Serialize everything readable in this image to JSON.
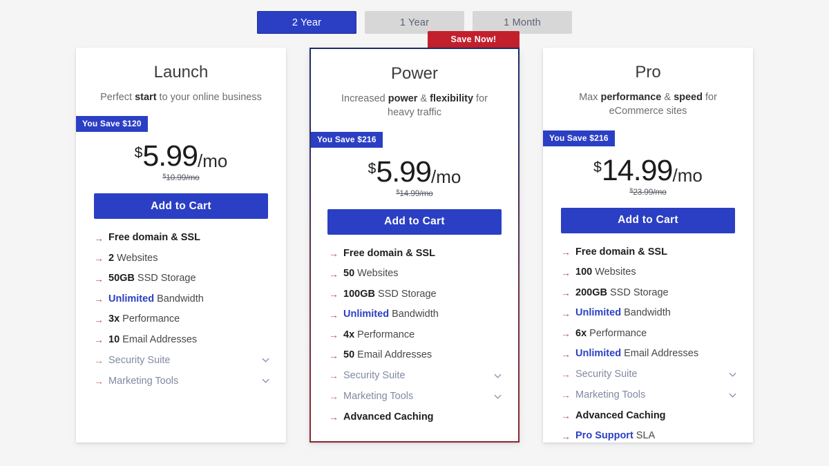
{
  "term_toggle": {
    "options": [
      {
        "label": "2 Year",
        "active": true
      },
      {
        "label": "1 Year",
        "active": false
      },
      {
        "label": "1 Month",
        "active": false
      }
    ]
  },
  "ribbon": {
    "label": "Save Now!",
    "color": "#c3202e"
  },
  "colors": {
    "accent_blue": "#2b3fc4",
    "ribbon_red": "#c3202e",
    "arrow_rose": "#b4515f",
    "muted_text": "#8189a3",
    "page_background": "#f5f5f5"
  },
  "icons": {
    "feature_arrow": "arrow-right-icon",
    "expand": "chevron-down-icon"
  },
  "plans": [
    {
      "name": "Launch",
      "tagline_pre": "Perfect ",
      "tagline_bold": "start",
      "tagline_post": " to your online business",
      "save_badge": "You Save $120",
      "currency": "$",
      "price": "5.99",
      "per": "/mo",
      "old_price": "10.99/mo",
      "cta": "Add to Cart",
      "featured": false,
      "features": [
        {
          "bold": "Free domain & SSL",
          "rest": "",
          "style": "allbold"
        },
        {
          "bold": "2",
          "rest": " Websites",
          "style": "normal"
        },
        {
          "bold": "50GB",
          "rest": " SSD Storage",
          "style": "normal"
        },
        {
          "bold": "Unlimited",
          "rest": " Bandwidth",
          "style": "highlight"
        },
        {
          "bold": "3x",
          "rest": " Performance",
          "style": "normal"
        },
        {
          "bold": "10",
          "rest": " Email Addresses",
          "style": "normal"
        },
        {
          "bold": "",
          "rest": "Security Suite",
          "style": "muted",
          "chevron": true
        },
        {
          "bold": "",
          "rest": "Marketing Tools",
          "style": "muted",
          "chevron": true
        }
      ]
    },
    {
      "name": "Power",
      "tagline_pre": "Increased ",
      "tagline_bold": "power",
      "tagline_mid": " & ",
      "tagline_bold2": "flexibility",
      "tagline_post": " for heavy traffic",
      "save_badge": "You Save $216",
      "currency": "$",
      "price": "5.99",
      "per": "/mo",
      "old_price": "14.99/mo",
      "cta": "Add to Cart",
      "featured": true,
      "features": [
        {
          "bold": "Free domain & SSL",
          "rest": "",
          "style": "allbold"
        },
        {
          "bold": "50",
          "rest": " Websites",
          "style": "normal"
        },
        {
          "bold": "100GB",
          "rest": " SSD Storage",
          "style": "normal"
        },
        {
          "bold": "Unlimited",
          "rest": " Bandwidth",
          "style": "highlight"
        },
        {
          "bold": "4x",
          "rest": " Performance",
          "style": "normal"
        },
        {
          "bold": "50",
          "rest": " Email Addresses",
          "style": "normal"
        },
        {
          "bold": "",
          "rest": "Security Suite",
          "style": "muted",
          "chevron": true
        },
        {
          "bold": "",
          "rest": "Marketing Tools",
          "style": "muted",
          "chevron": true
        },
        {
          "bold": "Advanced Caching",
          "rest": "",
          "style": "allbold"
        }
      ]
    },
    {
      "name": "Pro",
      "tagline_pre": "Max ",
      "tagline_bold": "performance",
      "tagline_mid": " & ",
      "tagline_bold2": "speed",
      "tagline_post": " for eCommerce sites",
      "save_badge": "You Save $216",
      "currency": "$",
      "price": "14.99",
      "per": "/mo",
      "old_price": "23.99/mo",
      "cta": "Add to Cart",
      "featured": false,
      "features": [
        {
          "bold": "Free domain & SSL",
          "rest": "",
          "style": "allbold"
        },
        {
          "bold": "100",
          "rest": " Websites",
          "style": "normal"
        },
        {
          "bold": "200GB",
          "rest": " SSD Storage",
          "style": "normal"
        },
        {
          "bold": "Unlimited",
          "rest": " Bandwidth",
          "style": "highlight"
        },
        {
          "bold": "6x",
          "rest": " Performance",
          "style": "normal"
        },
        {
          "bold": "Unlimited",
          "rest": " Email Addresses",
          "style": "highlight"
        },
        {
          "bold": "",
          "rest": "Security Suite",
          "style": "muted",
          "chevron": true
        },
        {
          "bold": "",
          "rest": "Marketing Tools",
          "style": "muted",
          "chevron": true
        },
        {
          "bold": "Advanced Caching",
          "rest": "",
          "style": "allbold"
        },
        {
          "bold": "Pro Support",
          "rest": " SLA",
          "style": "highlight"
        }
      ]
    }
  ]
}
